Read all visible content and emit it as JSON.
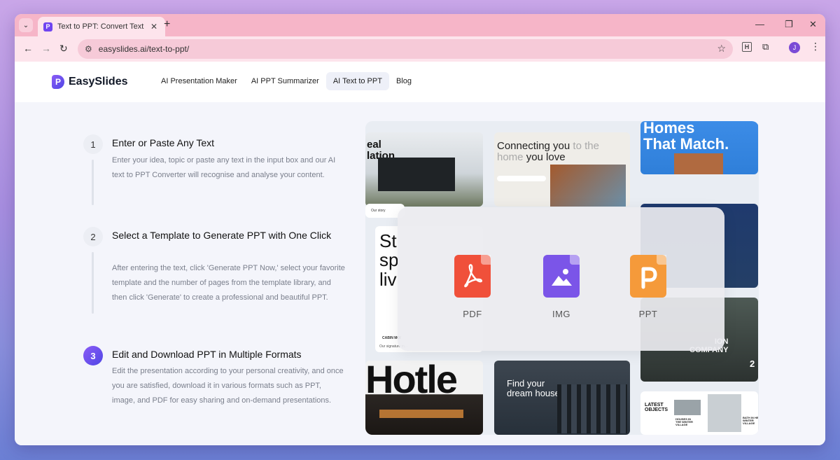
{
  "browser": {
    "tab_title": "Text to PPT: Convert Text Into PPT",
    "url": "easyslides.ai/text-to-ppt/",
    "profile_initial": "J",
    "extension_label": "H"
  },
  "site": {
    "brand": "EasySlides",
    "logo_letter": "P",
    "nav": [
      {
        "label": "AI Presentation Maker"
      },
      {
        "label": "AI PPT Summarizer"
      },
      {
        "label": "AI Text to PPT"
      },
      {
        "label": "Blog"
      }
    ]
  },
  "steps": [
    {
      "num": "1",
      "title": "Enter or Paste Any Text",
      "desc": "Enter your idea, topic or paste any text in the input box and our AI text to PPT Converter will recognise and analyse your content."
    },
    {
      "num": "2",
      "title": "Select a Template to Generate PPT with One Click",
      "desc": "After entering the text, click 'Generate PPT Now,' select your favorite template and the number of pages from the template library, and then click 'Generate' to create a professional and beautiful PPT."
    },
    {
      "num": "3",
      "title": "Edit and Download PPT in Multiple Formats",
      "desc": "Edit the presentation according to your personal creativity, and once you are satisfied, download it in various formats such as PPT, image, and PDF for easy sharing and on-demand presentations."
    }
  ],
  "thumbnails": {
    "t1": "eal\nlation",
    "t2a": "Connecting you",
    "t2b": "to the",
    "t2c": "home",
    "t2d": "you love",
    "t3": "Homes\nThat Match.",
    "t4": "St\nsp\nliv",
    "t4_small": "CABIN MOI",
    "t4_small2": "Our signature m...",
    "t5": "ION\nCOMPANY",
    "t5_num": "2",
    "t6": "Hotle",
    "t7": "Find your\ndream house",
    "t8a": "LATEST\nOBJECTS",
    "t8b": "HOUSES IN\nTHE WINTER\nVILLAGE",
    "t8c": "BATH IN HE\nWINTER\nVILLAGE",
    "t_small_label": "Our story"
  },
  "formats": [
    {
      "label": "PDF",
      "color": "#f0503a"
    },
    {
      "label": "IMG",
      "color": "#7b55e8"
    },
    {
      "label": "PPT",
      "color": "#f59a3a"
    }
  ]
}
